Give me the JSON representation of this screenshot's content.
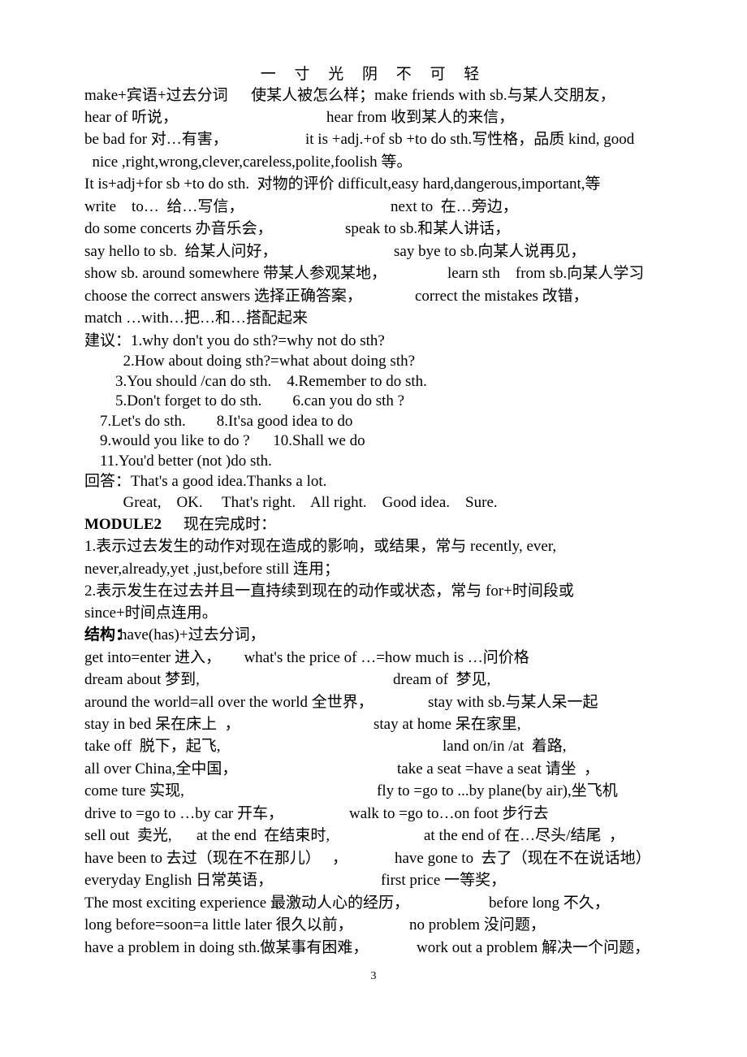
{
  "header": {
    "title": "一 寸 光 阴 不 可 轻"
  },
  "page_number": "3",
  "lines": [
    {
      "segments": [
        "make+宾语+过去分词      使某人被怎么样；make friends with sb.与某人交朋友，"
      ]
    },
    {
      "segments": [
        "hear of 听说，",
        "hear from 收到某人的来信，"
      ]
    },
    {
      "segments": [
        "be bad for 对…有害，",
        "it is +adj.+of sb +to do sth.写性格，品质 kind, good"
      ]
    },
    {
      "segments": [
        "  nice ,right,wrong,clever,careless,polite,foolish 等。"
      ]
    },
    {
      "segments": [
        "It is+adj+for sb +to do sth.  对物的评价 difficult,easy hard,dangerous,important,等"
      ]
    },
    {
      "segments": [
        "write    to…  给…写信，",
        "next to  在…旁边，"
      ]
    },
    {
      "segments": [
        "do some concerts 办音乐会，",
        "speak to sb.和某人讲话，"
      ]
    },
    {
      "segments": [
        "say hello to sb.  给某人问好，",
        "say bye to sb.向某人说再见，"
      ]
    },
    {
      "segments": [
        "show sb. around somewhere 带某人参观某地，",
        "learn sth    from sb.向某人学习"
      ]
    },
    {
      "segments": [
        "choose the correct answers 选择正确答案，",
        "correct the mistakes 改错，"
      ]
    },
    {
      "segments": [
        "match …with…把…和…搭配起来"
      ]
    },
    {
      "segments": [
        "建议：1.why don't you do sth?=why not do sth?"
      ]
    },
    {
      "segments": [
        "          2.How about doing sth?=what about doing sth?"
      ]
    },
    {
      "segments": [
        "        3.You should /can do sth.    4.Remember to do sth."
      ]
    },
    {
      "segments": [
        "        5.Don't forget to do sth.        6.can you do sth ?"
      ]
    },
    {
      "segments": [
        "    7.Let's do sth.        8.It'sa good idea to do"
      ]
    },
    {
      "segments": [
        "    9.would you like to do ?      10.Shall we do"
      ]
    },
    {
      "segments": [
        "    11.You'd better (not )do sth."
      ]
    },
    {
      "segments": [
        "回答：That's a good idea.Thanks a lot."
      ]
    },
    {
      "segments": [
        "          Great,    OK.     That's right.    All right.    Good idea.    Sure."
      ]
    },
    {
      "segments": [
        "MODULE2",
        "现在完成时："
      ]
    },
    {
      "segments": [
        "1.表示过去发生的动作对现在造成的影响，或结果，常与 recently, ever,"
      ]
    },
    {
      "segments": [
        "never,already,yet ,just,before still 连用；"
      ]
    },
    {
      "segments": [
        "2.表示发生在过去并且一直持续到现在的动作或状态，常与 for+时间段或"
      ]
    },
    {
      "segments": [
        "since+时间点连用。"
      ]
    },
    {
      "segments": [
        "结构：",
        "have(has)+过去分词，"
      ]
    },
    {
      "segments": [
        "get into=enter 进入，      what's the price of …=how much is …问价格"
      ]
    },
    {
      "segments": [
        "dream about 梦到,",
        "dream of  梦见,"
      ]
    },
    {
      "segments": [
        "around the world=all over the world 全世界，",
        "stay with sb.与某人呆一起"
      ]
    },
    {
      "segments": [
        "stay in bed 呆在床上  ，",
        "stay at home 呆在家里,"
      ]
    },
    {
      "segments": [
        "take off  脱下，起飞,",
        "land on/in /at  着路,"
      ]
    },
    {
      "segments": [
        "all over China,全中国，",
        "take a seat =have a seat 请坐  ，"
      ]
    },
    {
      "segments": [
        "come ture 实现,",
        "fly to =go to ...by plane(by air),坐飞机"
      ]
    },
    {
      "segments": [
        "drive to =go to …by car 开车，",
        "walk to =go to…on foot 步行去"
      ]
    },
    {
      "segments": [
        "sell out  卖光,",
        "at the end  在结束时,",
        "at the end of 在…尽头/结尾  ，"
      ]
    },
    {
      "segments": [
        "have been to 去过（现在不在那儿）   ，",
        "have gone to  去了（现在不在说话地）"
      ]
    },
    {
      "segments": [
        "everyday English 日常英语，",
        "first price 一等奖，"
      ]
    },
    {
      "segments": [
        "The most exciting experience 最激动人心的经历，",
        "before long 不久，"
      ]
    },
    {
      "segments": [
        "long before=soon=a little later 很久以前，",
        "no problem 没问题，"
      ]
    },
    {
      "segments": [
        "have a problem in doing sth.做某事有困难，",
        "work out a problem 解决一个问题，"
      ]
    }
  ]
}
